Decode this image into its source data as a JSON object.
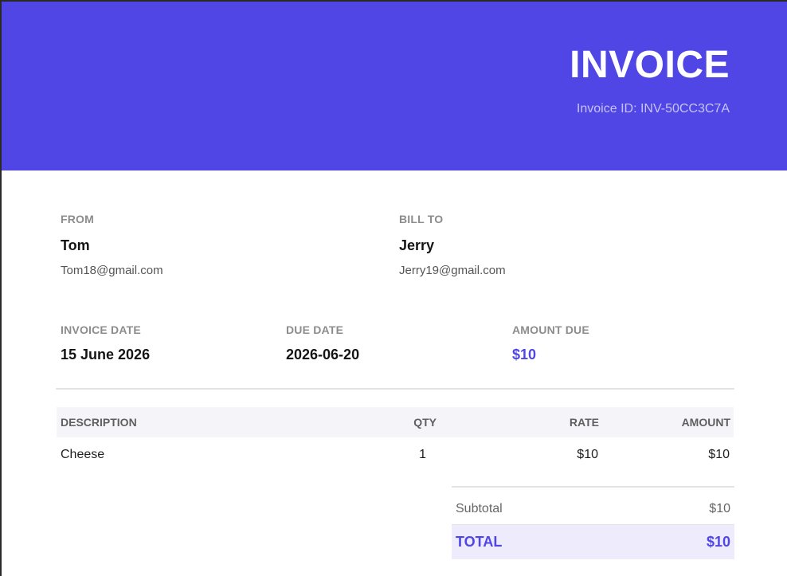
{
  "header": {
    "title": "INVOICE",
    "invoice_id": "Invoice ID: INV-50CC3C7A"
  },
  "from": {
    "label": "FROM",
    "name": "Tom",
    "email": "Tom18@gmail.com"
  },
  "bill_to": {
    "label": "BILL TO",
    "name": "Jerry",
    "email": "Jerry19@gmail.com"
  },
  "meta": {
    "invoice_date_label": "INVOICE DATE",
    "invoice_date": "15 June 2026",
    "due_date_label": "DUE DATE",
    "due_date": "2026-06-20",
    "amount_due_label": "AMOUNT DUE",
    "amount_due": "$10"
  },
  "table": {
    "headers": [
      "DESCRIPTION",
      "QTY",
      "RATE",
      "AMOUNT"
    ],
    "rows": [
      {
        "description": "Cheese",
        "qty": "1",
        "rate": "$10",
        "amount": "$10"
      }
    ]
  },
  "summary": {
    "subtotal_label": "Subtotal",
    "subtotal": "$10",
    "total_label": "TOTAL",
    "total": "$10"
  },
  "colors": {
    "accent": "#4f46e5",
    "header_bg": "#4f46e5",
    "total_bg": "#eeecfc"
  }
}
